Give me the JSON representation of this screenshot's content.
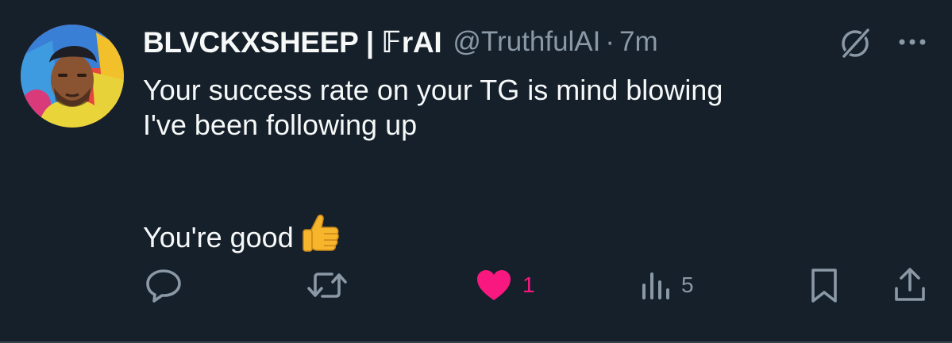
{
  "tweet": {
    "author": {
      "display_name": "BLVCKXSHEEP | 𝔽rAI",
      "handle": "@TruthfulAI",
      "separator": "·",
      "time": "7m"
    },
    "body": {
      "line1": "Your success rate on your TG is mind blowing",
      "line2": "I've been following up",
      "line3": "You're good",
      "emoji": "thumbs-up"
    },
    "actions": {
      "reply": {
        "icon": "reply-icon",
        "count": ""
      },
      "retweet": {
        "icon": "retweet-icon",
        "count": ""
      },
      "like": {
        "icon": "heart-icon",
        "count": "1",
        "active": true
      },
      "views": {
        "icon": "views-icon",
        "count": "5"
      },
      "bookmark": {
        "icon": "bookmark-icon",
        "count": ""
      },
      "share": {
        "icon": "share-icon",
        "count": ""
      }
    },
    "colors": {
      "background": "#15202b",
      "text": "#f7f9f9",
      "muted": "#8b98a5",
      "like": "#f91880"
    }
  }
}
